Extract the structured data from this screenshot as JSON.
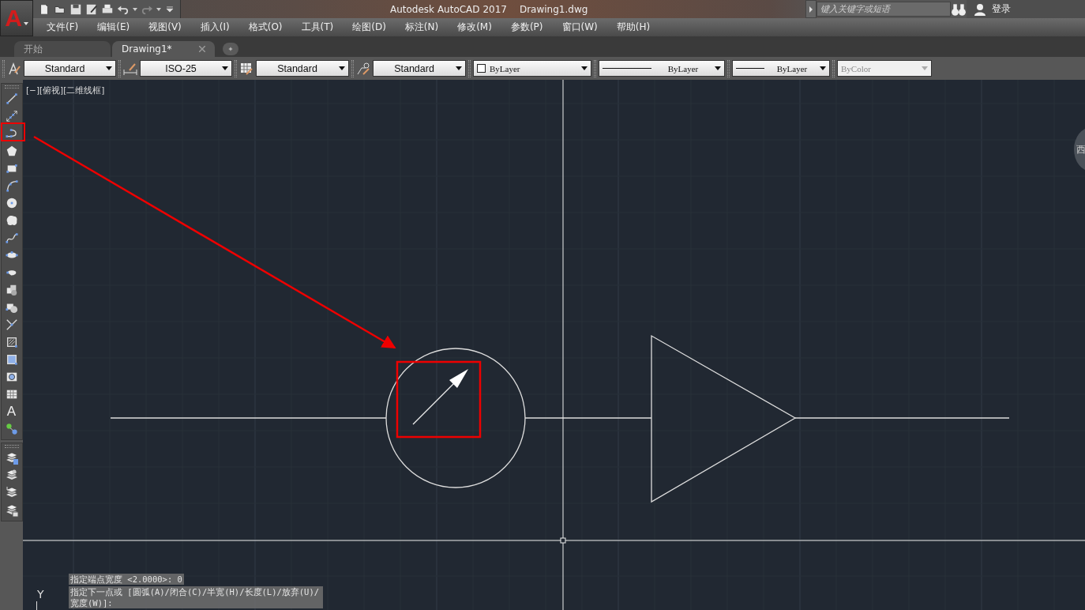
{
  "app_button": {
    "label": "A"
  },
  "window": {
    "title": "Autodesk AutoCAD 2017",
    "file": "Drawing1.dwg"
  },
  "search": {
    "placeholder": "键入关键字或短语"
  },
  "sign_in": {
    "label": "登录"
  },
  "menu": [
    "文件(F)",
    "编辑(E)",
    "视图(V)",
    "插入(I)",
    "格式(O)",
    "工具(T)",
    "绘图(D)",
    "标注(N)",
    "修改(M)",
    "参数(P)",
    "窗口(W)",
    "帮助(H)"
  ],
  "tabs": [
    {
      "label": "开始",
      "selected": false,
      "closable": false
    },
    {
      "label": "Drawing1*",
      "selected": true,
      "closable": true
    }
  ],
  "properties": [
    {
      "kind": "text-style",
      "value": "Standard",
      "disabled": false
    },
    {
      "kind": "dim-style",
      "value": "ISO-25",
      "disabled": false
    },
    {
      "kind": "table-style",
      "value": "Standard",
      "disabled": false
    },
    {
      "kind": "leader-style",
      "value": "Standard",
      "disabled": false
    },
    {
      "kind": "color",
      "value": "ByLayer",
      "disabled": false
    },
    {
      "kind": "linetype",
      "value": "ByLayer",
      "disabled": false
    },
    {
      "kind": "lineweight",
      "value": "ByLayer",
      "disabled": false
    },
    {
      "kind": "plot-style",
      "value": "ByColor",
      "disabled": true
    }
  ],
  "left_toolbar": {
    "text_glyph": "A"
  },
  "viewport": {
    "label": "[−][俯视][二维线框]",
    "compass": "西",
    "ucs_axis": "Y"
  },
  "command_line": [
    "指定端点宽度 <2.0000>: 0",
    "指定下一点或 [圆弧(A)/闭合(C)/半宽(H)/长度(L)/放弃(U)/宽度(W)]:"
  ]
}
